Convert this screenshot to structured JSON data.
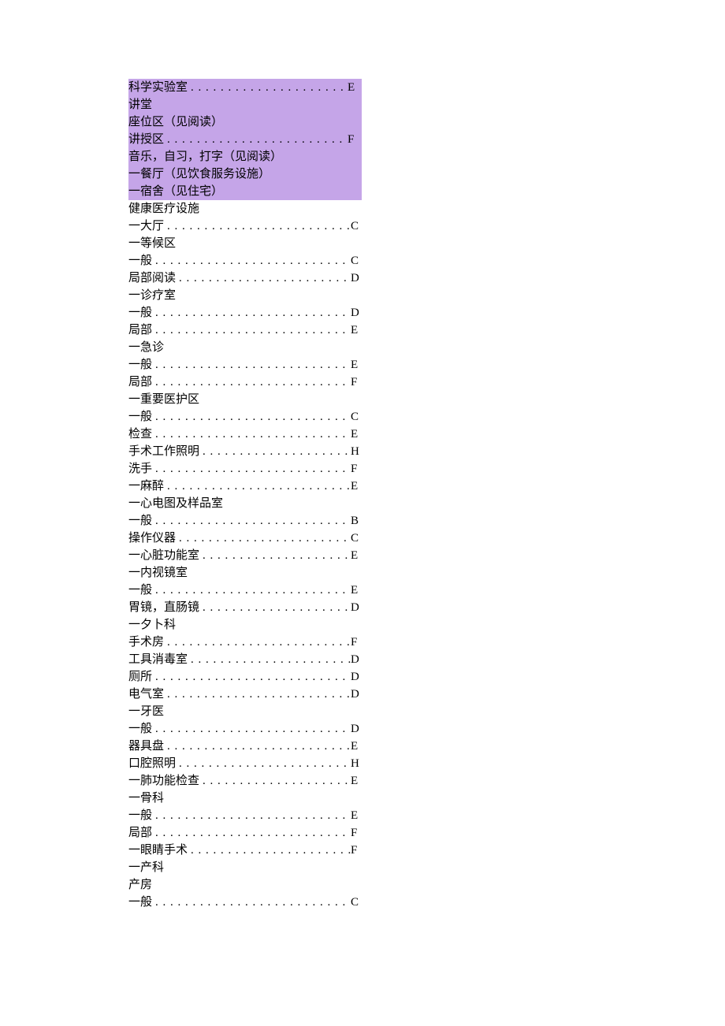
{
  "rows": [
    {
      "label": "科学实验室",
      "value": "E",
      "hl": true
    },
    {
      "label": "讲堂",
      "value": "",
      "hl": true
    },
    {
      "label": "座位区（见阅读）",
      "value": "",
      "hl": true
    },
    {
      "label": "讲授区",
      "value": "F",
      "hl": true
    },
    {
      "label": "音乐，自习，打字（见阅读）",
      "value": "",
      "hl": true
    },
    {
      "label": "一餐厅（见饮食服务设施）",
      "value": "",
      "hl": true
    },
    {
      "label": "一宿舍（见住宅）",
      "value": "",
      "hl": true
    },
    {
      "label": "健康医疗设施",
      "value": "",
      "hl": false
    },
    {
      "label": "一大厅",
      "value": "C",
      "hl": false
    },
    {
      "label": "一等候区",
      "value": "",
      "hl": false
    },
    {
      "label": "一般",
      "value": "C",
      "hl": false
    },
    {
      "label": "局部阅读",
      "value": "D",
      "hl": false
    },
    {
      "label": "一诊疗室",
      "value": "",
      "hl": false
    },
    {
      "label": "一般",
      "value": "D",
      "hl": false
    },
    {
      "label": "局部",
      "value": "E",
      "hl": false
    },
    {
      "label": "一急诊",
      "value": "",
      "hl": false
    },
    {
      "label": "一般",
      "value": "E",
      "hl": false
    },
    {
      "label": "局部",
      "value": "F",
      "hl": false
    },
    {
      "label": "一重要医护区",
      "value": "",
      "hl": false
    },
    {
      "label": "一般",
      "value": "C",
      "hl": false
    },
    {
      "label": "检查",
      "value": "E",
      "hl": false
    },
    {
      "label": "手术工作照明",
      "value": "H",
      "hl": false
    },
    {
      "label": "洗手",
      "value": "F",
      "hl": false
    },
    {
      "label": "一麻醉",
      "value": "E",
      "hl": false
    },
    {
      "label": "一心电图及样品室",
      "value": "",
      "hl": false
    },
    {
      "label": "一般",
      "value": "B",
      "hl": false
    },
    {
      "label": "操作仪器",
      "value": "C",
      "hl": false
    },
    {
      "label": "一心脏功能室",
      "value": "E",
      "hl": false
    },
    {
      "label": "一内视镜室",
      "value": "",
      "hl": false
    },
    {
      "label": "一般",
      "value": "E",
      "hl": false
    },
    {
      "label": "胃镜，直肠镜",
      "value": "D",
      "hl": false
    },
    {
      "label": "一夕卜科",
      "value": "",
      "hl": false
    },
    {
      "label": "手术房",
      "value": "F",
      "hl": false
    },
    {
      "label": "工具消毒室",
      "value": "D",
      "hl": false
    },
    {
      "label": "厕所",
      "value": "D",
      "hl": false
    },
    {
      "label": "电气室",
      "value": "D",
      "hl": false
    },
    {
      "label": "一牙医",
      "value": "",
      "hl": false
    },
    {
      "label": "一般",
      "value": "D",
      "hl": false
    },
    {
      "label": "器具盘",
      "value": "E",
      "hl": false
    },
    {
      "label": "口腔照明",
      "value": "H",
      "hl": false
    },
    {
      "label": "一肺功能检查",
      "value": "E",
      "hl": false
    },
    {
      "label": "一骨科",
      "value": "",
      "hl": false
    },
    {
      "label": "一般",
      "value": "E",
      "hl": false
    },
    {
      "label": "局部",
      "value": "F",
      "hl": false
    },
    {
      "label": "一眼睛手术",
      "value": "F",
      "hl": false
    },
    {
      "label": "一产科",
      "value": "",
      "hl": false
    },
    {
      "label": "产房",
      "value": "",
      "hl": false
    },
    {
      "label": "一般",
      "value": "C",
      "hl": false
    }
  ]
}
